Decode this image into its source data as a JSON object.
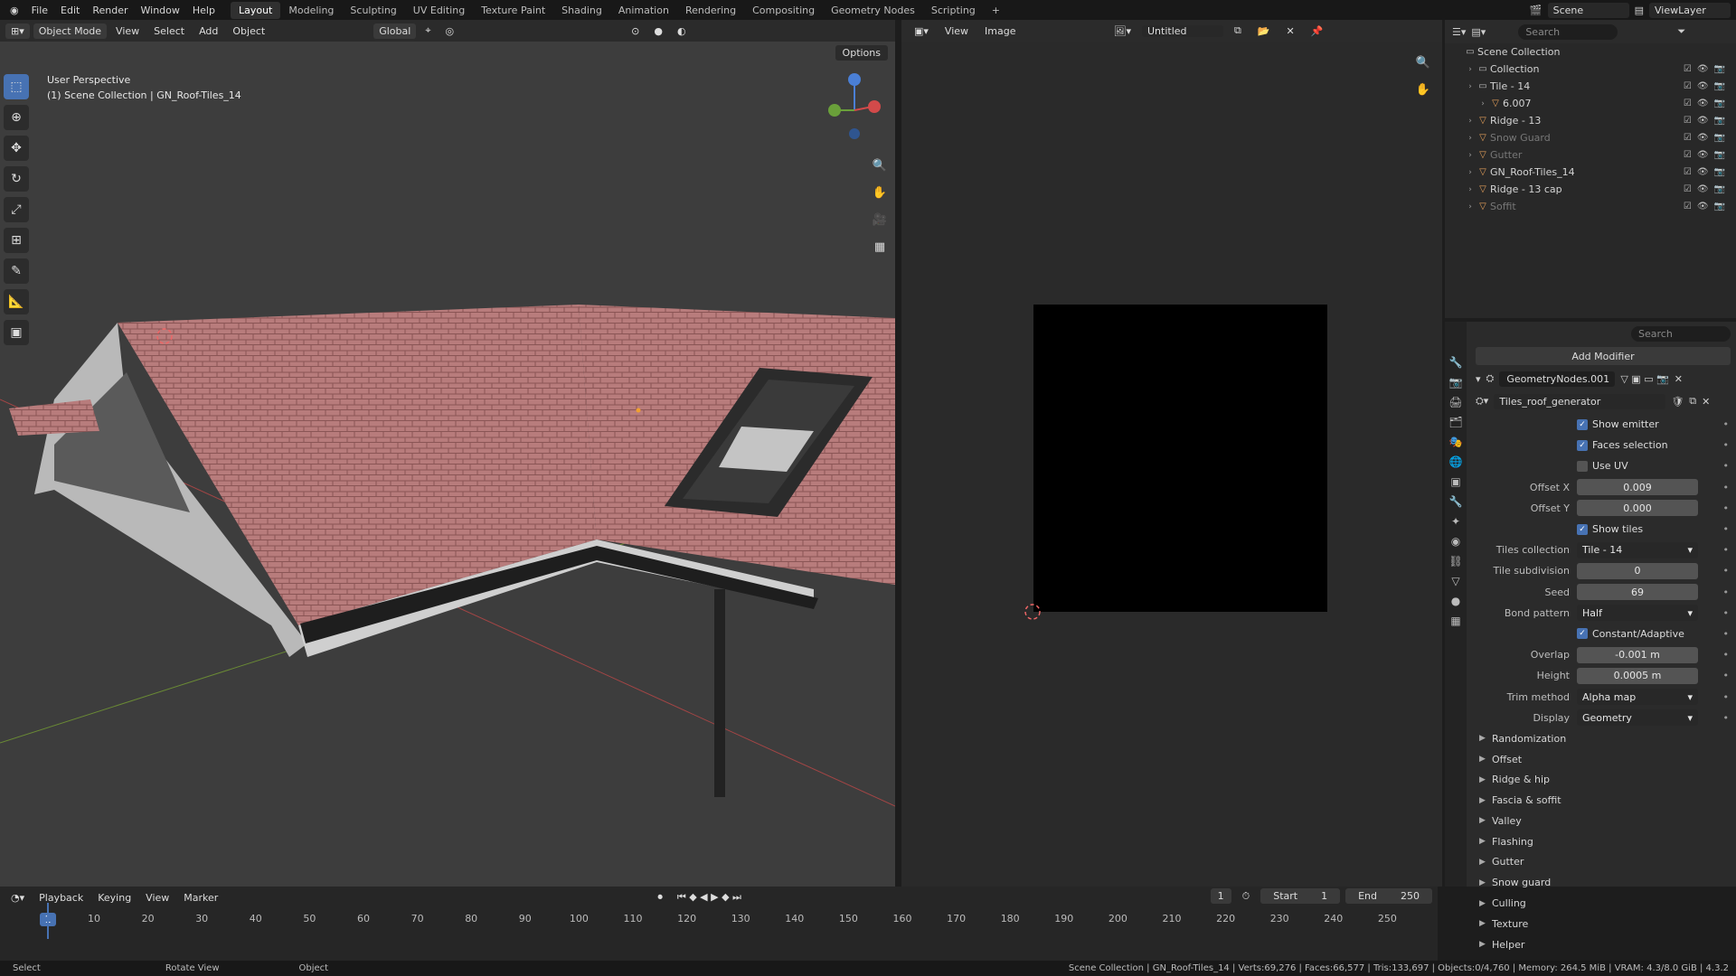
{
  "menu": [
    "File",
    "Edit",
    "Render",
    "Window",
    "Help"
  ],
  "workspaces": [
    "Layout",
    "Modeling",
    "Sculpting",
    "UV Editing",
    "Texture Paint",
    "Shading",
    "Animation",
    "Rendering",
    "Compositing",
    "Geometry Nodes",
    "Scripting"
  ],
  "active_workspace": "Layout",
  "scene": "Scene",
  "view_layer": "ViewLayer",
  "viewport": {
    "mode": "Object Mode",
    "menus": [
      "View",
      "Select",
      "Add",
      "Object"
    ],
    "orientation": "Global",
    "options": "Options",
    "info_line1": "User Perspective",
    "info_line2": "(1) Scene Collection | GN_Roof-Tiles_14"
  },
  "image_editor": {
    "menus": [
      "View",
      "Image"
    ],
    "image_name": "Untitled"
  },
  "outliner": {
    "search_placeholder": "Search",
    "items": [
      {
        "label": "Scene Collection",
        "depth": 0,
        "type": "scene",
        "dim": false
      },
      {
        "label": "Collection",
        "depth": 1,
        "type": "collection",
        "dim": false
      },
      {
        "label": "Tile - 14",
        "depth": 1,
        "type": "collection",
        "dim": false
      },
      {
        "label": "6.007",
        "depth": 2,
        "type": "object",
        "dim": false
      },
      {
        "label": "Ridge - 13",
        "depth": 1,
        "type": "object",
        "dim": false
      },
      {
        "label": "Snow Guard",
        "depth": 1,
        "type": "object",
        "dim": true
      },
      {
        "label": "Gutter",
        "depth": 1,
        "type": "object",
        "dim": true
      },
      {
        "label": "GN_Roof-Tiles_14",
        "depth": 1,
        "type": "object",
        "dim": false
      },
      {
        "label": "Ridge - 13 cap",
        "depth": 1,
        "type": "object",
        "dim": false
      },
      {
        "label": "Soffit",
        "depth": 1,
        "type": "object",
        "dim": true
      }
    ]
  },
  "properties": {
    "search_placeholder": "Search",
    "add_modifier": "Add Modifier",
    "modifier_name": "GeometryNodes.001",
    "node_group": "Tiles_roof_generator",
    "rows": [
      {
        "kind": "check",
        "label": "Show emitter",
        "checked": true
      },
      {
        "kind": "check",
        "label": "Faces selection",
        "checked": true
      },
      {
        "kind": "check",
        "label": "Use UV",
        "checked": false
      },
      {
        "kind": "value",
        "label": "Offset X",
        "value": "0.009"
      },
      {
        "kind": "value",
        "label": "Offset Y",
        "value": "0.000"
      },
      {
        "kind": "check",
        "label": "Show tiles",
        "checked": true
      },
      {
        "kind": "select",
        "label": "Tiles collection",
        "value": "Tile - 14"
      },
      {
        "kind": "value",
        "label": "Tile subdivision",
        "value": "0"
      },
      {
        "kind": "value",
        "label": "Seed",
        "value": "69"
      },
      {
        "kind": "select",
        "label": "Bond pattern",
        "value": "Half"
      },
      {
        "kind": "check",
        "label": "Constant/Adaptive",
        "checked": true
      },
      {
        "kind": "value",
        "label": "Overlap",
        "value": "-0.001 m"
      },
      {
        "kind": "value",
        "label": "Height",
        "value": "0.0005 m"
      },
      {
        "kind": "select",
        "label": "Trim method",
        "value": "Alpha map"
      },
      {
        "kind": "select",
        "label": "Display",
        "value": "Geometry"
      }
    ],
    "panels": [
      "Randomization",
      "Offset",
      "Ridge & hip",
      "Fascia & soffit",
      "Valley",
      "Flashing",
      "Gutter",
      "Snow guard",
      "Culling",
      "Texture",
      "Helper"
    ]
  },
  "timeline": {
    "menus": [
      "Playback",
      "Keying",
      "View",
      "Marker"
    ],
    "current_frame": "1",
    "start_label": "Start",
    "start": "1",
    "end_label": "End",
    "end": "250",
    "ticks": [
      "10",
      "20",
      "30",
      "40",
      "50",
      "60",
      "70",
      "80",
      "90",
      "100",
      "110",
      "120",
      "130",
      "140",
      "150",
      "160",
      "170",
      "180",
      "190",
      "200",
      "210",
      "220",
      "230",
      "240",
      "250"
    ]
  },
  "statusbar": {
    "left": [
      "Select",
      "Rotate View",
      "Object"
    ],
    "right": "Scene Collection | GN_Roof-Tiles_14 | Verts:69,276 | Faces:66,577 | Tris:133,697 | Objects:0/4,760 | Memory: 264.5 MiB | VRAM: 4.3/8.0 GiB | 4.3.2"
  }
}
